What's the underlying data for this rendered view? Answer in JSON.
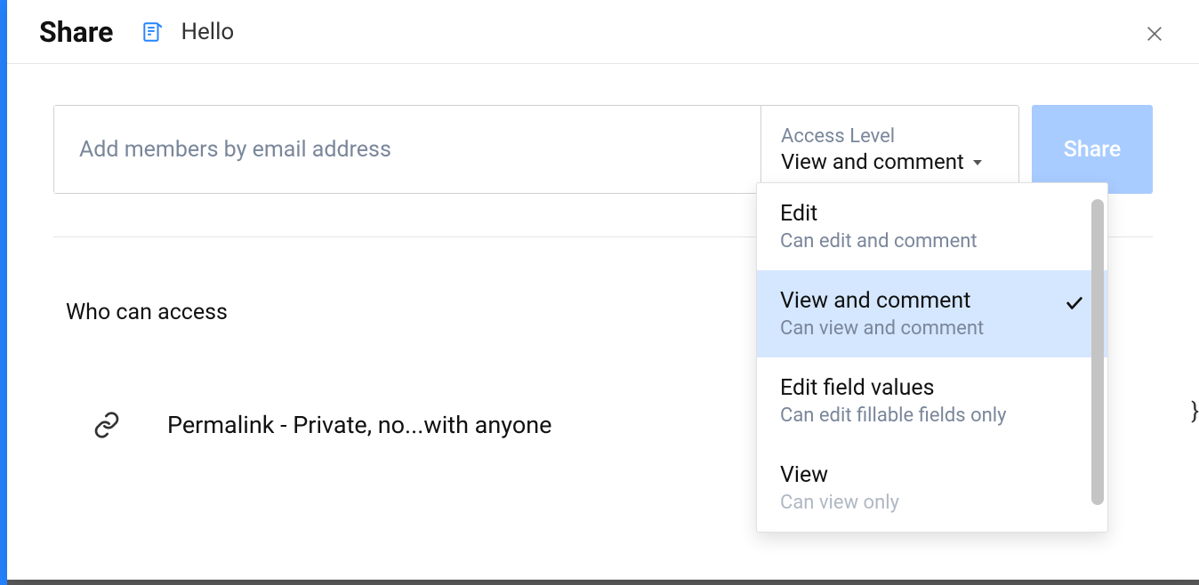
{
  "header": {
    "title": "Share",
    "docName": "Hello"
  },
  "invite": {
    "placeholder": "Add members by email address",
    "accessLabel": "Access Level",
    "accessValue": "View and comment",
    "shareButton": "Share"
  },
  "section": {
    "whoCanAccess": "Who can access",
    "permalink": "Permalink - Private, no...with anyone"
  },
  "dropdown": {
    "items": [
      {
        "title": "Edit",
        "desc": "Can edit and comment",
        "selected": false
      },
      {
        "title": "View and comment",
        "desc": "Can view and comment",
        "selected": true
      },
      {
        "title": "Edit field values",
        "desc": "Can edit fillable fields only",
        "selected": false
      },
      {
        "title": "View",
        "desc": "Can view only",
        "selected": false
      }
    ]
  },
  "stray": {
    "curly": "}"
  }
}
